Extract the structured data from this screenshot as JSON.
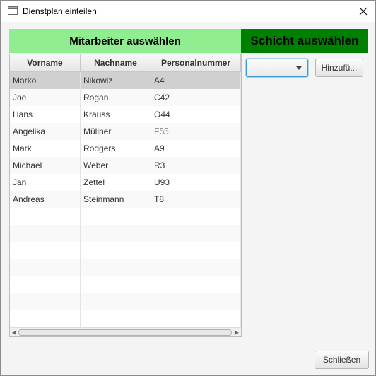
{
  "window": {
    "title": "Dienstplan einteilen"
  },
  "headers": {
    "employees": "Mitarbeiter auswählen",
    "shift": "Schicht auswählen"
  },
  "table": {
    "columns": [
      "Vorname",
      "Nachname",
      "Personalnummer"
    ],
    "rows": [
      [
        "Marko",
        "Nikowiz",
        "A4"
      ],
      [
        "Joe",
        "Rogan",
        "C42"
      ],
      [
        "Hans",
        "Krauss",
        "O44"
      ],
      [
        "Angelika",
        "Müllner",
        "F55"
      ],
      [
        "Mark",
        "Rodgers",
        "A9"
      ],
      [
        "Michael",
        "Weber",
        "R3"
      ],
      [
        "Jan",
        "Zettel",
        "U93"
      ],
      [
        "Andreas",
        "Steinmann",
        "T8"
      ]
    ],
    "selected_row": 0
  },
  "shift_select": {
    "value": ""
  },
  "buttons": {
    "add": "Hinzufü...",
    "close": "Schließen"
  },
  "colors": {
    "employees_header_bg": "#90ee90",
    "shift_header_bg": "#008000",
    "selected_row_bg": "#d0d0d0",
    "focus_accent": "#3c99d8"
  }
}
